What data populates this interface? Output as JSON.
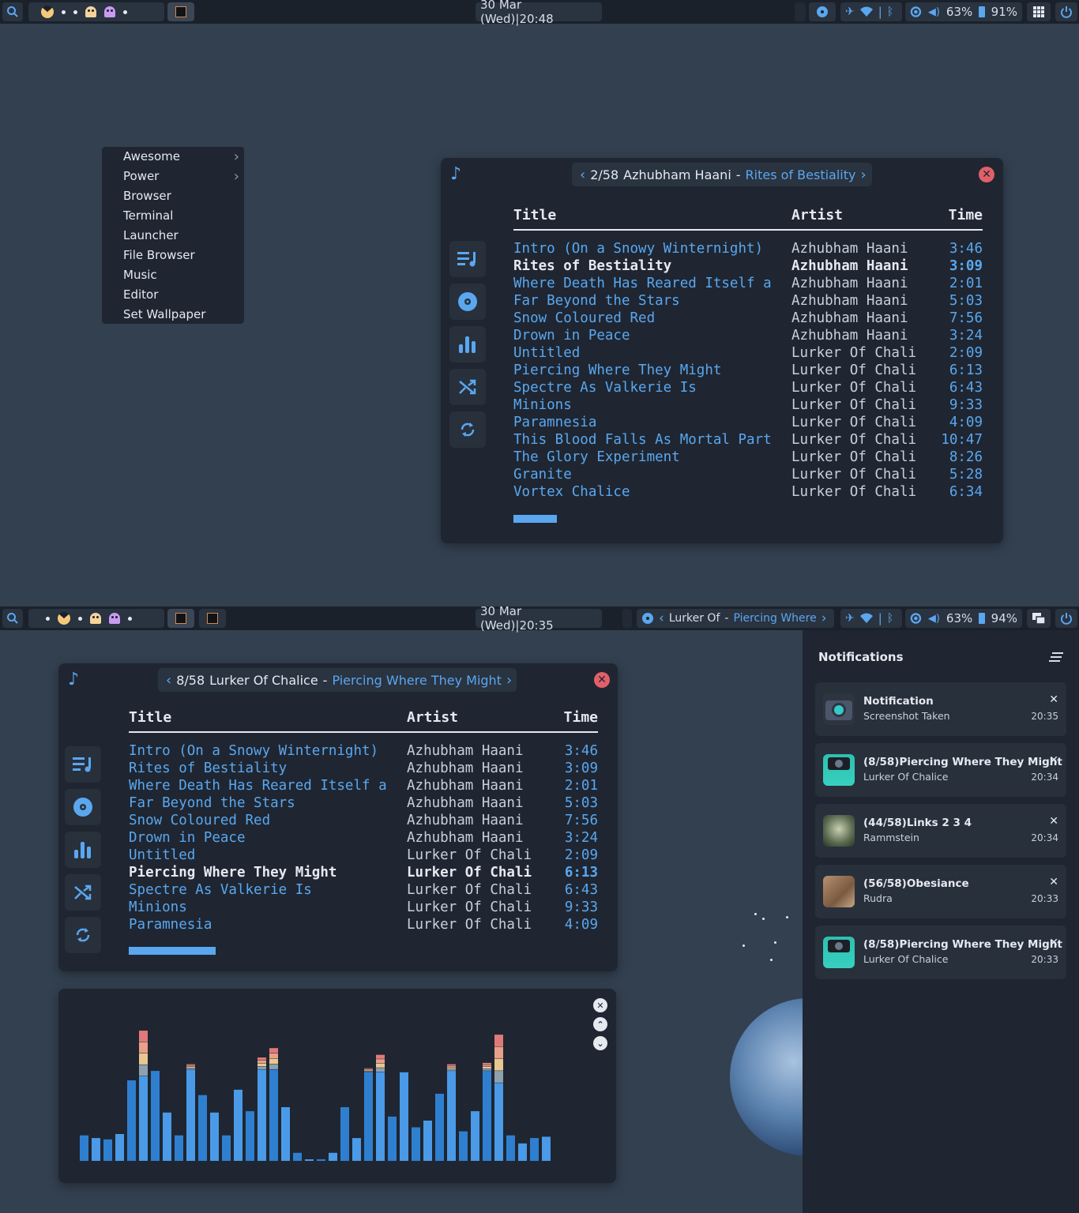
{
  "top_bar": {
    "datetime": "30 Mar (Wed)|20:48",
    "volume": "63%",
    "battery": "91%"
  },
  "bottom_bar": {
    "datetime": "30 Mar (Wed)|20:35",
    "now_playing_artist": "Lurker Of",
    "now_playing_sep": "-",
    "now_playing_song": "Piercing Where",
    "volume": "63%",
    "battery": "94%"
  },
  "menu": {
    "items": [
      "Awesome",
      "Power",
      "Browser",
      "Terminal",
      "Launcher",
      "File Browser",
      "Music",
      "Editor",
      "Set Wallpaper"
    ]
  },
  "player_top": {
    "position": "2/58",
    "artist": "Azhubham Haani",
    "sep": "-",
    "song": "Rites of Bestiality",
    "headers": {
      "title": "Title",
      "artist": "Artist",
      "time": "Time"
    },
    "rows": [
      {
        "title": "Intro (On a Snowy Winternight)",
        "artist": "Azhubham Haani",
        "time": "3:46"
      },
      {
        "title": "Rites of Bestiality",
        "artist": "Azhubham Haani",
        "time": "3:09"
      },
      {
        "title": "Where Death Has Reared Itself a",
        "artist": "Azhubham Haani",
        "time": "2:01"
      },
      {
        "title": "Far Beyond the Stars",
        "artist": "Azhubham Haani",
        "time": "5:03"
      },
      {
        "title": "Snow Coloured Red",
        "artist": "Azhubham Haani",
        "time": "7:56"
      },
      {
        "title": "Drown in Peace",
        "artist": "Azhubham Haani",
        "time": "3:24"
      },
      {
        "title": "Untitled",
        "artist": "Lurker Of Chali",
        "time": "2:09"
      },
      {
        "title": "Piercing Where They Might",
        "artist": "Lurker Of Chali",
        "time": "6:13"
      },
      {
        "title": "Spectre As Valkerie Is",
        "artist": "Lurker Of Chali",
        "time": "6:43"
      },
      {
        "title": "Minions",
        "artist": "Lurker Of Chali",
        "time": "9:33"
      },
      {
        "title": "Paramnesia",
        "artist": "Lurker Of Chali",
        "time": "4:09"
      },
      {
        "title": "This Blood Falls As Mortal Part",
        "artist": "Lurker Of Chali",
        "time": "10:47"
      },
      {
        "title": "The Glory Experiment",
        "artist": "Lurker Of Chali",
        "time": "8:26"
      },
      {
        "title": "Granite",
        "artist": "Lurker Of Chali",
        "time": "5:28"
      },
      {
        "title": "Vortex Chalice",
        "artist": "Lurker Of Chali",
        "time": "6:34"
      }
    ],
    "current_index": 1
  },
  "player_bottom": {
    "position": "8/58",
    "artist": "Lurker Of Chalice",
    "sep": "-",
    "song": "Piercing Where They Might",
    "headers": {
      "title": "Title",
      "artist": "Artist",
      "time": "Time"
    },
    "rows": [
      {
        "title": "Intro (On a Snowy Winternight)",
        "artist": "Azhubham Haani",
        "time": "3:46"
      },
      {
        "title": "Rites of Bestiality",
        "artist": "Azhubham Haani",
        "time": "3:09"
      },
      {
        "title": "Where Death Has Reared Itself a",
        "artist": "Azhubham Haani",
        "time": "2:01"
      },
      {
        "title": "Far Beyond the Stars",
        "artist": "Azhubham Haani",
        "time": "5:03"
      },
      {
        "title": "Snow Coloured Red",
        "artist": "Azhubham Haani",
        "time": "7:56"
      },
      {
        "title": "Drown in Peace",
        "artist": "Azhubham Haani",
        "time": "3:24"
      },
      {
        "title": "Untitled",
        "artist": "Lurker Of Chali",
        "time": "2:09"
      },
      {
        "title": "Piercing Where They Might",
        "artist": "Lurker Of Chali",
        "time": "6:13"
      },
      {
        "title": "Spectre As Valkerie Is",
        "artist": "Lurker Of Chali",
        "time": "6:43"
      },
      {
        "title": "Minions",
        "artist": "Lurker Of Chali",
        "time": "9:33"
      },
      {
        "title": "Paramnesia",
        "artist": "Lurker Of Chali",
        "time": "4:09"
      }
    ],
    "current_index": 7
  },
  "visualizer": {
    "levels": [
      0.19,
      0.17,
      0.16,
      0.2,
      0.6,
      0.63,
      0.67,
      0.36,
      0.19,
      0.68,
      0.49,
      0.36,
      0.19,
      0.53,
      0.37,
      0.68,
      0.68,
      0.4,
      0.06,
      0.01,
      0.01,
      0.06,
      0.4,
      0.17,
      0.66,
      0.66,
      0.33,
      0.66,
      0.25,
      0.3,
      0.5,
      0.67,
      0.22,
      0.37,
      0.67,
      0.58,
      0.19,
      0.13,
      0.17,
      0.18
    ],
    "peaks": [
      0,
      0,
      0,
      0,
      0,
      0.97,
      0,
      0,
      0,
      0.72,
      0,
      0,
      0,
      0,
      0,
      0.77,
      0.84,
      0,
      0,
      0,
      0,
      0,
      0,
      0,
      0.69,
      0.79,
      0,
      0,
      0,
      0,
      0,
      0.72,
      0,
      0,
      0.73,
      0.94,
      0,
      0,
      0,
      0
    ]
  },
  "notifications": {
    "title": "Notifications",
    "items": [
      {
        "title": "Notification",
        "subtitle": "Screenshot Taken",
        "time": "20:35",
        "thumb": "camera-icon"
      },
      {
        "title": "(8/58)Piercing Where They Might",
        "subtitle": "Lurker Of Chalice",
        "time": "20:34",
        "thumb": "album-art"
      },
      {
        "title": "(44/58)Links 2 3 4",
        "subtitle": "Rammstein",
        "time": "20:34",
        "thumb": "album-art"
      },
      {
        "title": "(56/58)Obesiance",
        "subtitle": "Rudra",
        "time": "20:33",
        "thumb": "album-art"
      },
      {
        "title": "(8/58)Piercing Where They Might",
        "subtitle": "Lurker Of Chalice",
        "time": "20:33",
        "thumb": "album-art"
      }
    ]
  },
  "colors": {
    "accent": "#5aa7f0",
    "panel": "#1f2631",
    "bar": "#1b212b",
    "desktop": "#334050",
    "close": "#e0606a"
  }
}
